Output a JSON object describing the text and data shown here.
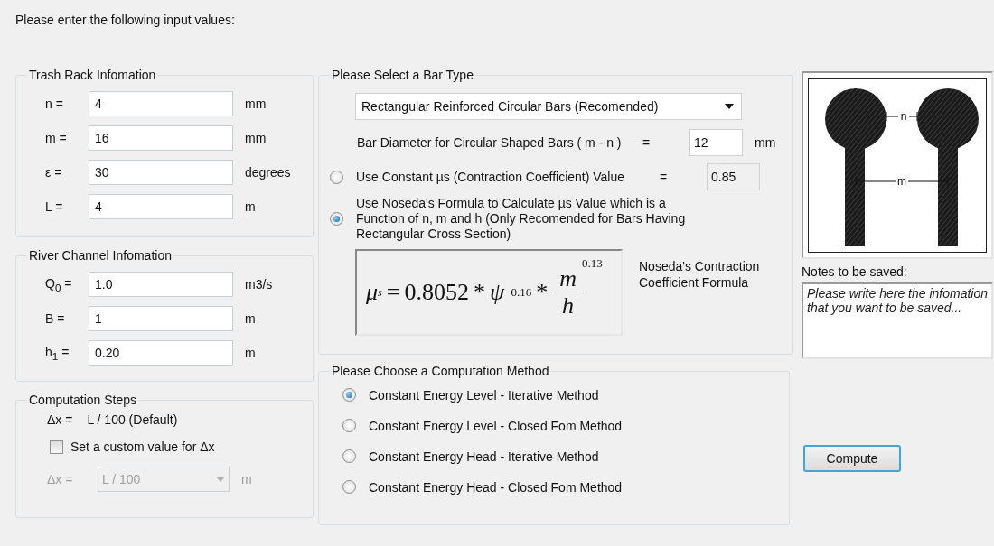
{
  "heading": "Please enter the following input values:",
  "trash_rack": {
    "title": "Trash Rack Infomation",
    "rows": [
      {
        "label": "n =",
        "value": "4",
        "unit": "mm"
      },
      {
        "label": "m =",
        "value": "16",
        "unit": "mm"
      },
      {
        "label": "ε =",
        "value": "30",
        "unit": "degrees"
      },
      {
        "label": "L =",
        "value": "4",
        "unit": "m"
      }
    ]
  },
  "river_channel": {
    "title": "River Channel Infomation",
    "rows": [
      {
        "label": "Q$_{0}$ =",
        "value": "1.0",
        "unit": "m3/s"
      },
      {
        "label": "B =",
        "value": "1",
        "unit": "m"
      },
      {
        "label": "h$_{1}$ =",
        "value": "0.20",
        "unit": "m"
      }
    ]
  },
  "computation_steps": {
    "title": "Computation Steps",
    "default_label": "Δx =",
    "default_value": "L / 100 (Default)",
    "custom": {
      "label": "Set a custom value for Δx",
      "checked": false
    },
    "custom_field": {
      "label": "Δx =",
      "value": "L / 100",
      "unit": "m",
      "disabled": true
    }
  },
  "bar_type": {
    "title": "Please Select a Bar Type",
    "dropdown": {
      "value": "Rectangular Reinforced Circular Bars (Recomended)"
    },
    "diameter": {
      "label": "Bar Diameter for Circular Shaped Bars ( m - n )",
      "equals": "=",
      "value": "12",
      "unit": "mm"
    },
    "options": [
      {
        "kind": "constant",
        "selected": false,
        "label": "Use Constant µs (Contraction Coefficient) Value",
        "equals": "=",
        "value": "0.85"
      },
      {
        "kind": "formula",
        "selected": true,
        "label": "Use Noseda's Formula to Calculate µs Value which is a Function of n, m and h (Only Recomended for Bars Having Rectangular Cross Section)"
      }
    ],
    "formula": {
      "symbol": "μ",
      "symbol_sub": "s",
      "equals": "=",
      "coefficient": "0.8052",
      "times": "*",
      "psi": "ψ",
      "psi_exp": "−0.16",
      "times2": "*",
      "numerator": "m",
      "denominator": "h",
      "exponent": "0.13"
    },
    "formula_caption": "Noseda's Contraction Coefficient Formula"
  },
  "method": {
    "title": "Please Choose a Computation Method",
    "options": [
      {
        "label": "Constant Energy Level  - Iterative Method",
        "selected": true
      },
      {
        "label": "Constant Energy Level - Closed Fom Method",
        "selected": false
      },
      {
        "label": "Constant Energy Head - Iterative Method",
        "selected": false
      },
      {
        "label": "Constant Energy Head - Closed Fom Method",
        "selected": false
      }
    ]
  },
  "diagram": {
    "gap_label": "n",
    "spacing_label": "m"
  },
  "notes": {
    "label": "Notes to be saved:",
    "placeholder": "Please write here the infomation that you want to be saved..."
  },
  "compute_button": "Compute"
}
